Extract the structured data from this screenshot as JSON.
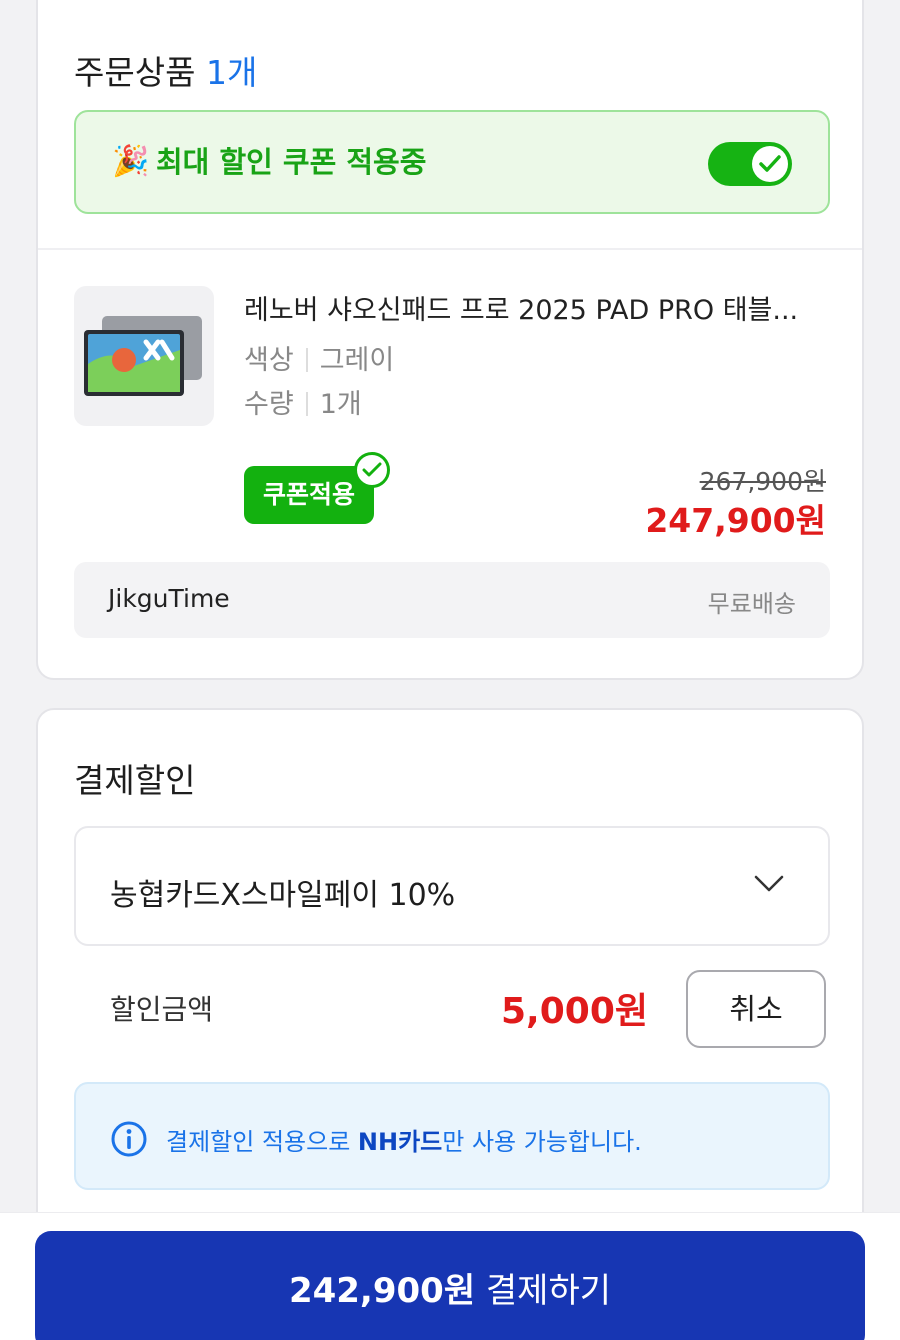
{
  "order": {
    "title": "주문상품",
    "count": "1개",
    "coupon_banner": {
      "text": "최대 할인 쿠폰 적용중",
      "toggle_on": true
    },
    "product": {
      "name": "레노버 샤오신패드 프로 2025 PAD PRO 태블...",
      "options": [
        {
          "label": "색상",
          "value": "그레이"
        },
        {
          "label": "수량",
          "value": "1개"
        }
      ],
      "coupon_badge": "쿠폰적용",
      "original_price": "267,900원",
      "sale_price": "247,900원"
    },
    "seller": {
      "name": "JikguTime",
      "shipping": "무료배송"
    }
  },
  "discount": {
    "title": "결제할인",
    "selected_option": "농협카드X스마일페이 10%",
    "amount_label": "할인금액",
    "amount_value": "5,000원",
    "cancel_label": "취소",
    "notice_prefix": "결제할인 적용으로 ",
    "notice_bold": "NH카드",
    "notice_suffix": "만 사용 가능합니다."
  },
  "footer": {
    "pay_amount": "242,900원",
    "pay_label": "결제하기"
  },
  "colors": {
    "accent_blue": "#1736b3",
    "coupon_green": "#13b10f",
    "price_red": "#e01b1b"
  }
}
